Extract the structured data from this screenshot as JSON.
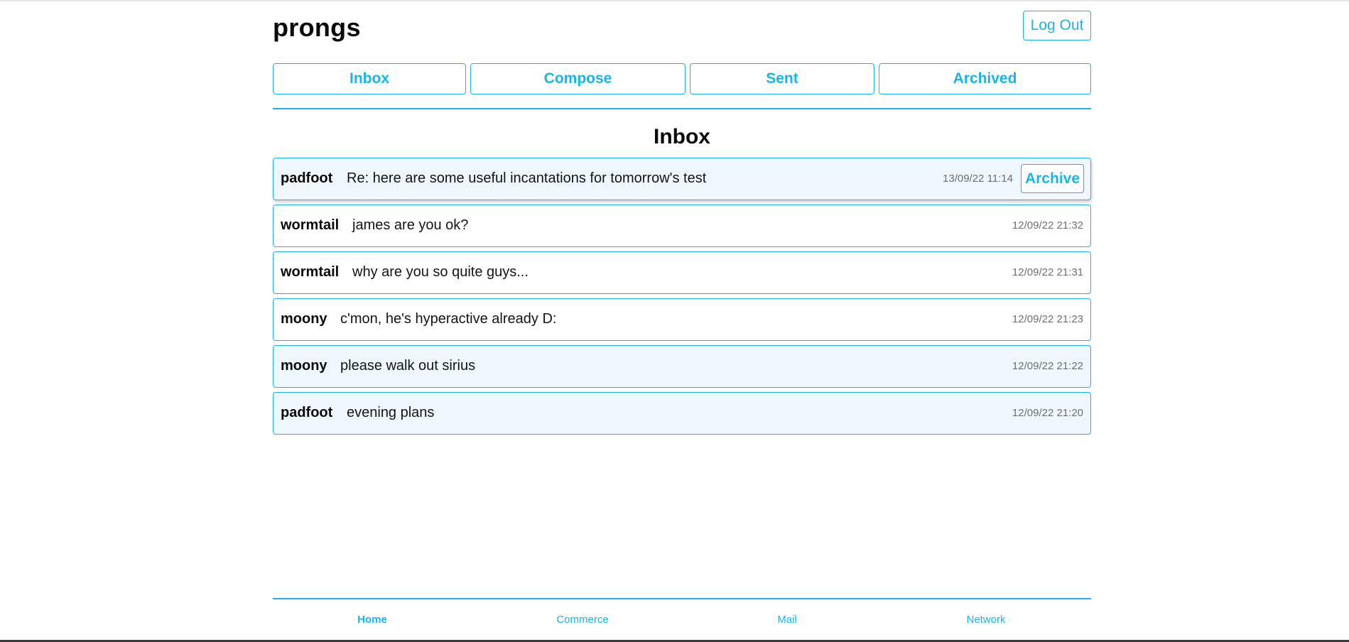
{
  "user": {
    "name": "prongs"
  },
  "header": {
    "logout_label": "Log Out"
  },
  "nav": {
    "inbox": "Inbox",
    "compose": "Compose",
    "sent": "Sent",
    "archived": "Archived"
  },
  "mailbox": {
    "title": "Inbox",
    "archive_label": "Archive",
    "emails": [
      {
        "sender": "padfoot",
        "subject": "Re: here are some useful incantations for tomorrow's test",
        "timestamp": "13/09/22 11:14",
        "read": true
      },
      {
        "sender": "wormtail",
        "subject": "james are you ok?",
        "timestamp": "12/09/22 21:32",
        "read": false
      },
      {
        "sender": "wormtail",
        "subject": "why are you so quite guys...",
        "timestamp": "12/09/22 21:31",
        "read": false
      },
      {
        "sender": "moony",
        "subject": "c'mon, he's hyperactive already D:",
        "timestamp": "12/09/22 21:23",
        "read": false
      },
      {
        "sender": "moony",
        "subject": "please walk out sirius",
        "timestamp": "12/09/22 21:22",
        "read": true
      },
      {
        "sender": "padfoot",
        "subject": "evening plans",
        "timestamp": "12/09/22 21:20",
        "read": true
      }
    ]
  },
  "footer": {
    "home": "Home",
    "commerce": "Commerce",
    "mail": "Mail",
    "network": "Network"
  },
  "colors": {
    "accent": "#19b4ec",
    "read_row_background": "#eef7fd",
    "unread_row_background": "#ffffff",
    "timestamp": "#6f6f6f"
  }
}
